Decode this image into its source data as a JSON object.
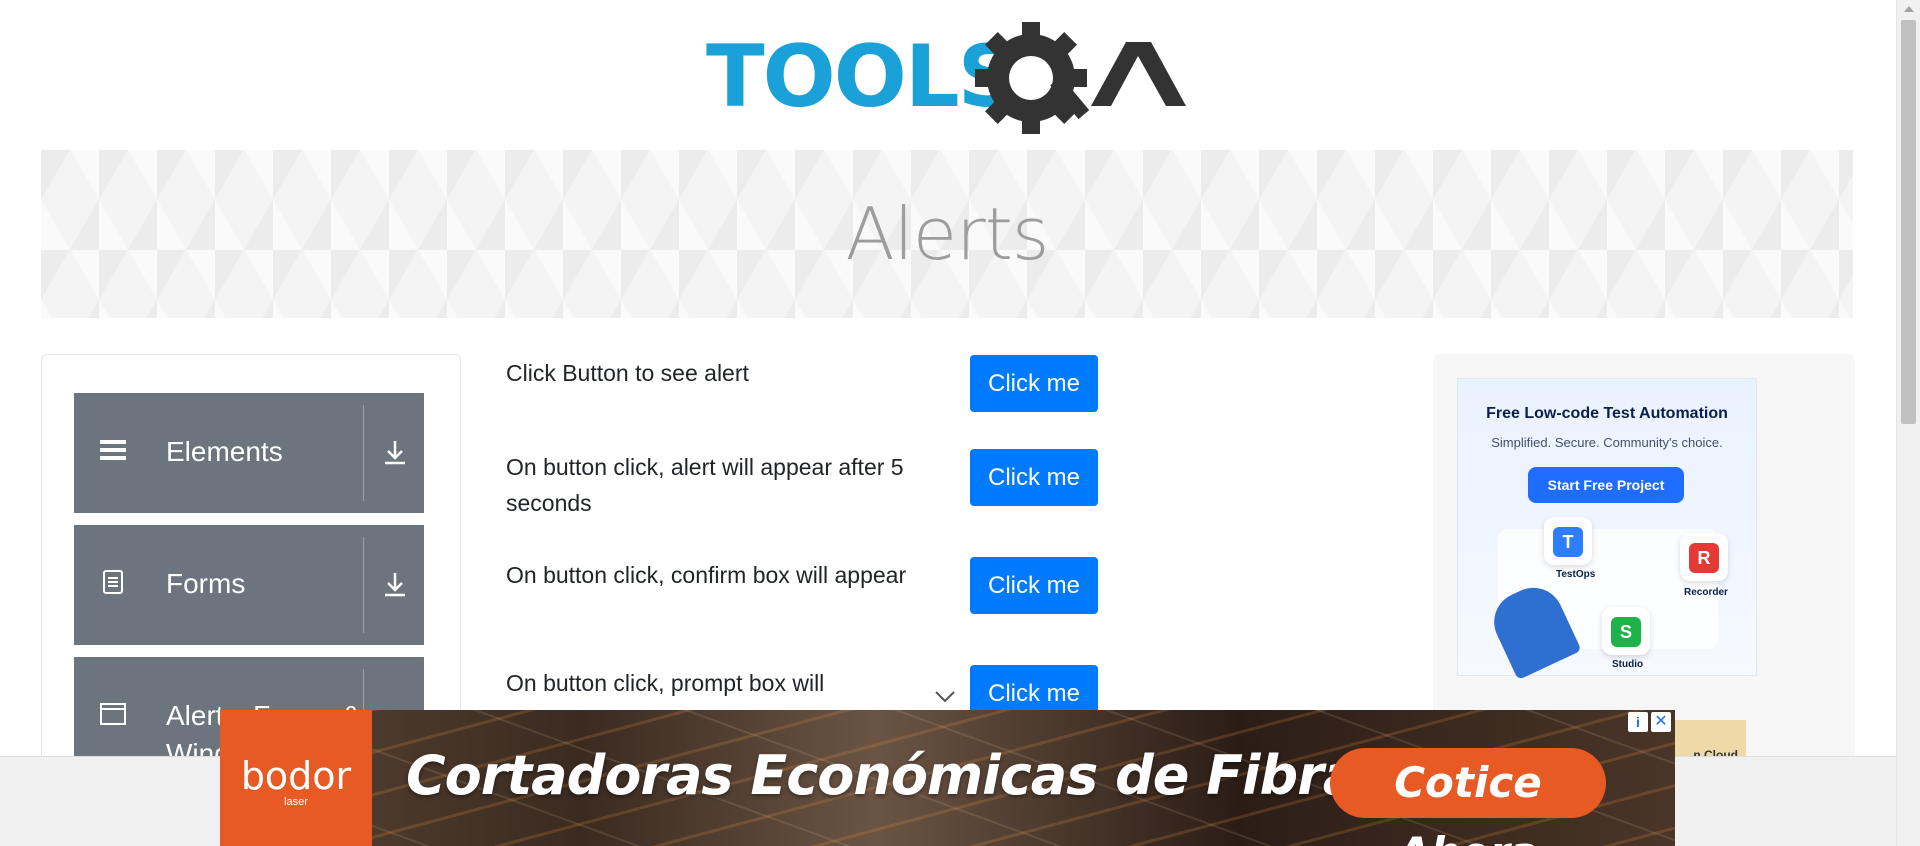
{
  "header": {
    "logo_text": "TOOLSQA"
  },
  "banner": {
    "title": "Alerts"
  },
  "left_menu": {
    "groups": [
      {
        "label": "Elements",
        "icon": "hamburger-icon"
      },
      {
        "label": "Forms",
        "icon": "document-icon"
      },
      {
        "label": "Alerts, Frame & Windows",
        "icon": "browser-window-icon"
      }
    ]
  },
  "main": {
    "rows": [
      {
        "text": "Click Button to see alert",
        "button": "Click me"
      },
      {
        "text": "On button click, alert will appear after 5 seconds",
        "button": "Click me"
      },
      {
        "text": "On button click, confirm box will appear",
        "button": "Click me"
      },
      {
        "text": "On button click, prompt box will",
        "button": "Click me"
      }
    ]
  },
  "right_ad": {
    "title": "Free Low-code Test Automation",
    "subtitle": "Simplified. Secure. Community's choice.",
    "cta": "Start Free Project",
    "tiles": [
      "TestOps",
      "Recorder",
      "Studio"
    ],
    "tile_letters": [
      "T",
      "R",
      "S"
    ],
    "partial_card_text": "n Cloud"
  },
  "bottom_ad": {
    "brand": "bodor",
    "brand_sub": "laser",
    "headline": "Cortadoras Económicas de Fibra Láser",
    "button": "Cotice Ahora",
    "info_icon": "i",
    "close_icon": "✕",
    "brand_color": "#e85a24"
  },
  "colors": {
    "primary_button": "#007bff",
    "menu_group": "#6c757d",
    "logo_blue": "#1aa1d8",
    "logo_dark": "#333333"
  }
}
